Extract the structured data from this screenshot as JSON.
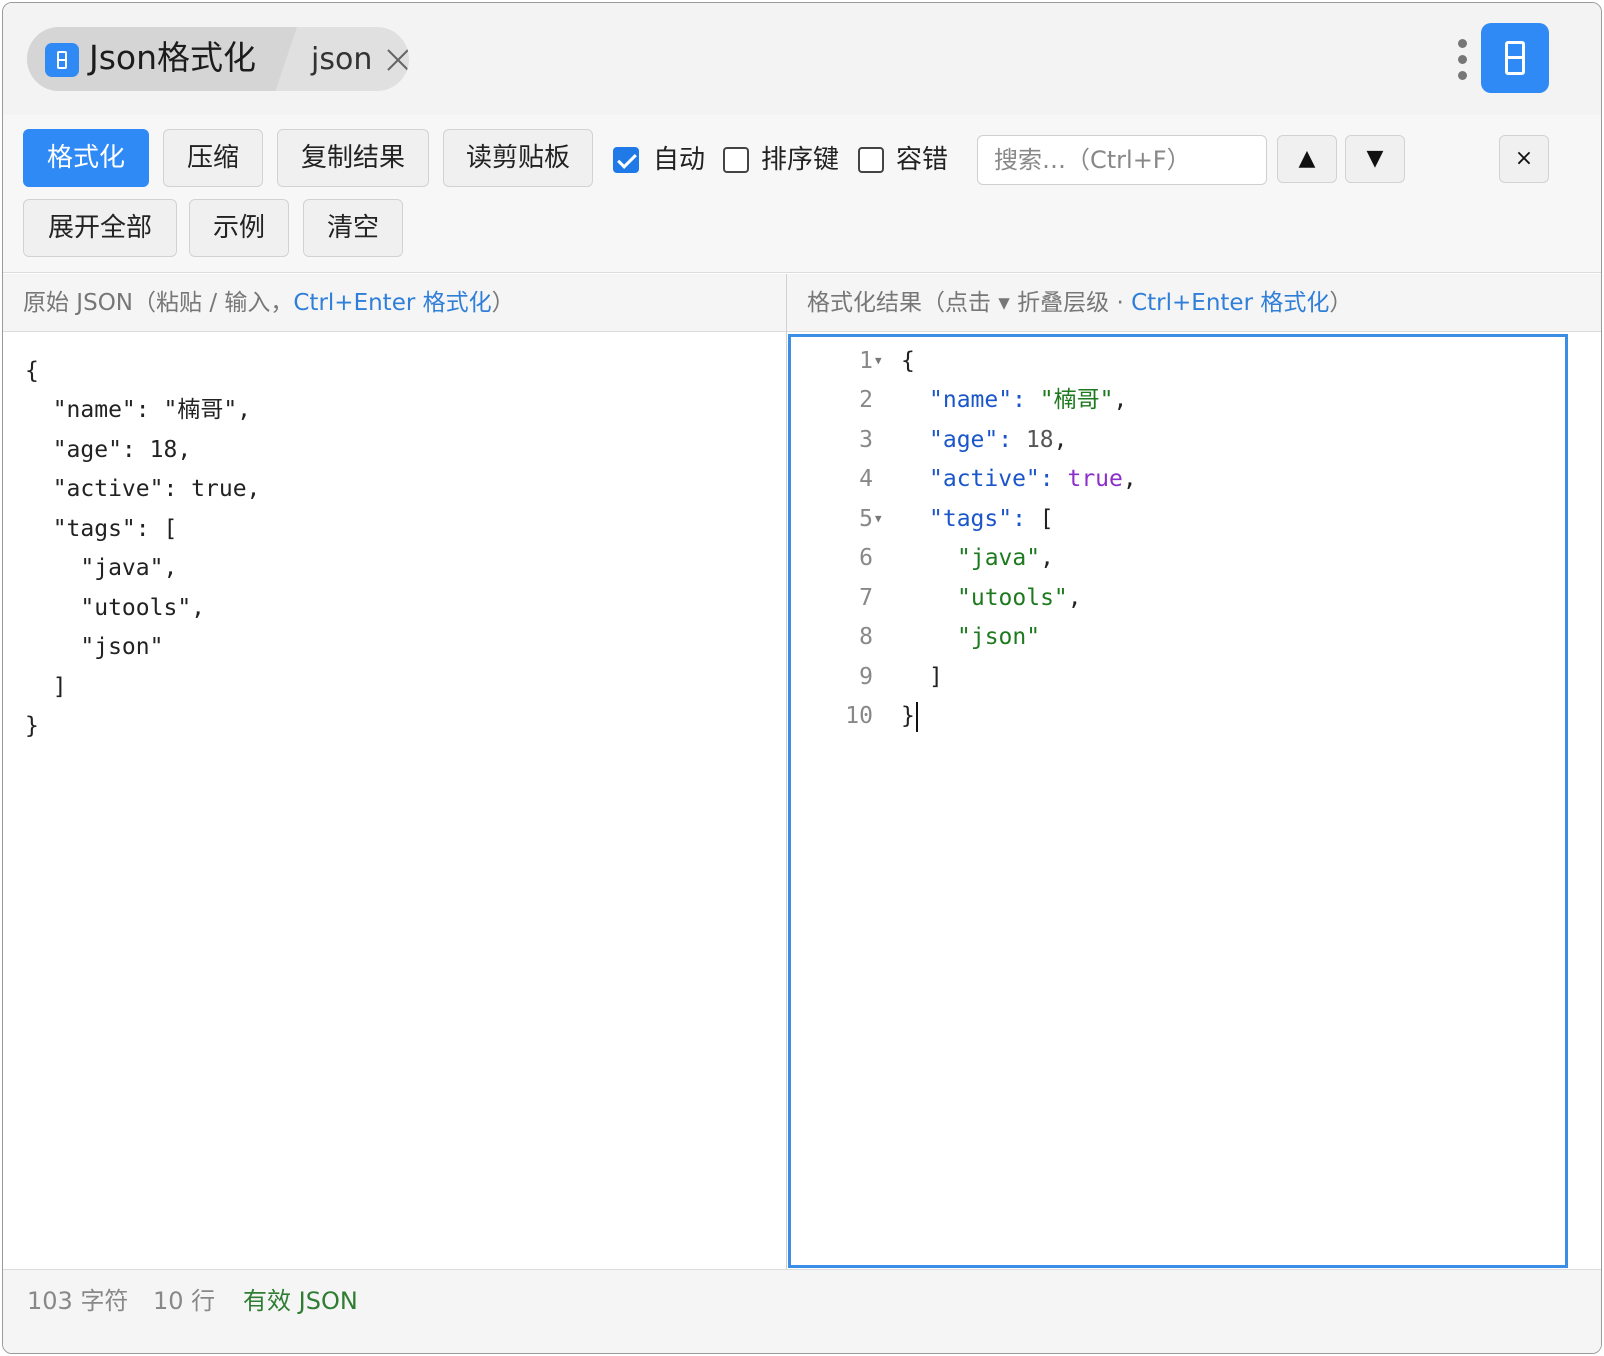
{
  "titlebar": {
    "app_title": "Json格式化",
    "sub_title": "json"
  },
  "toolbar": {
    "format_label": "格式化",
    "compress_label": "压缩",
    "copy_result_label": "复制结果",
    "read_clipboard_label": "读剪贴板",
    "auto_label": "自动",
    "auto_checked": true,
    "sort_keys_label": "排序键",
    "sort_keys_checked": false,
    "tolerant_label": "容错",
    "tolerant_checked": false,
    "search_placeholder": "搜索…（Ctrl+F）",
    "search_value": "",
    "prev_label": "▲",
    "next_label": "▼",
    "close_label": "×",
    "expand_all_label": "展开全部",
    "example_label": "示例",
    "clear_label": "清空"
  },
  "left_panel": {
    "header": "原始 JSON（粘贴 / 输入，",
    "header_hint": "Ctrl+Enter 格式化",
    "header_end": "）",
    "lines": [
      "{",
      "  \"name\": \"楠哥\",",
      "  \"age\": 18,",
      "  \"active\": true,",
      "  \"tags\": [",
      "    \"java\",",
      "    \"utools\",",
      "    \"json\"",
      "  ]",
      "}"
    ]
  },
  "right_panel": {
    "header": "格式化结果（点击 ▾ 折叠层级 · ",
    "header_hint": "Ctrl+Enter 格式化",
    "header_end": "）",
    "line_numbers": [
      "1",
      "2",
      "3",
      "4",
      "5",
      "6",
      "7",
      "8",
      "9",
      "10"
    ],
    "code": {
      "l1_open": "{",
      "key_name": "\"name\"",
      "val_name": "\"楠哥\"",
      "key_age": "\"age\"",
      "val_age": "18",
      "key_active": "\"active\"",
      "val_active": "true",
      "key_tags": "\"tags\"",
      "tags_open": "[",
      "tag_1": "\"java\"",
      "tag_2": "\"utools\"",
      "tag_3": "\"json\"",
      "tags_close": "]",
      "l10_close": "}",
      "colon": ": ",
      "comma": ","
    }
  },
  "status": {
    "chars": "103 字符",
    "lines": "10 行",
    "validity": "有效 JSON"
  },
  "colors": {
    "accent": "#2f8af5",
    "key": "#1a56c9",
    "string": "#1e7a1e",
    "boolean": "#8b2fc9",
    "valid": "#2e7d32"
  }
}
